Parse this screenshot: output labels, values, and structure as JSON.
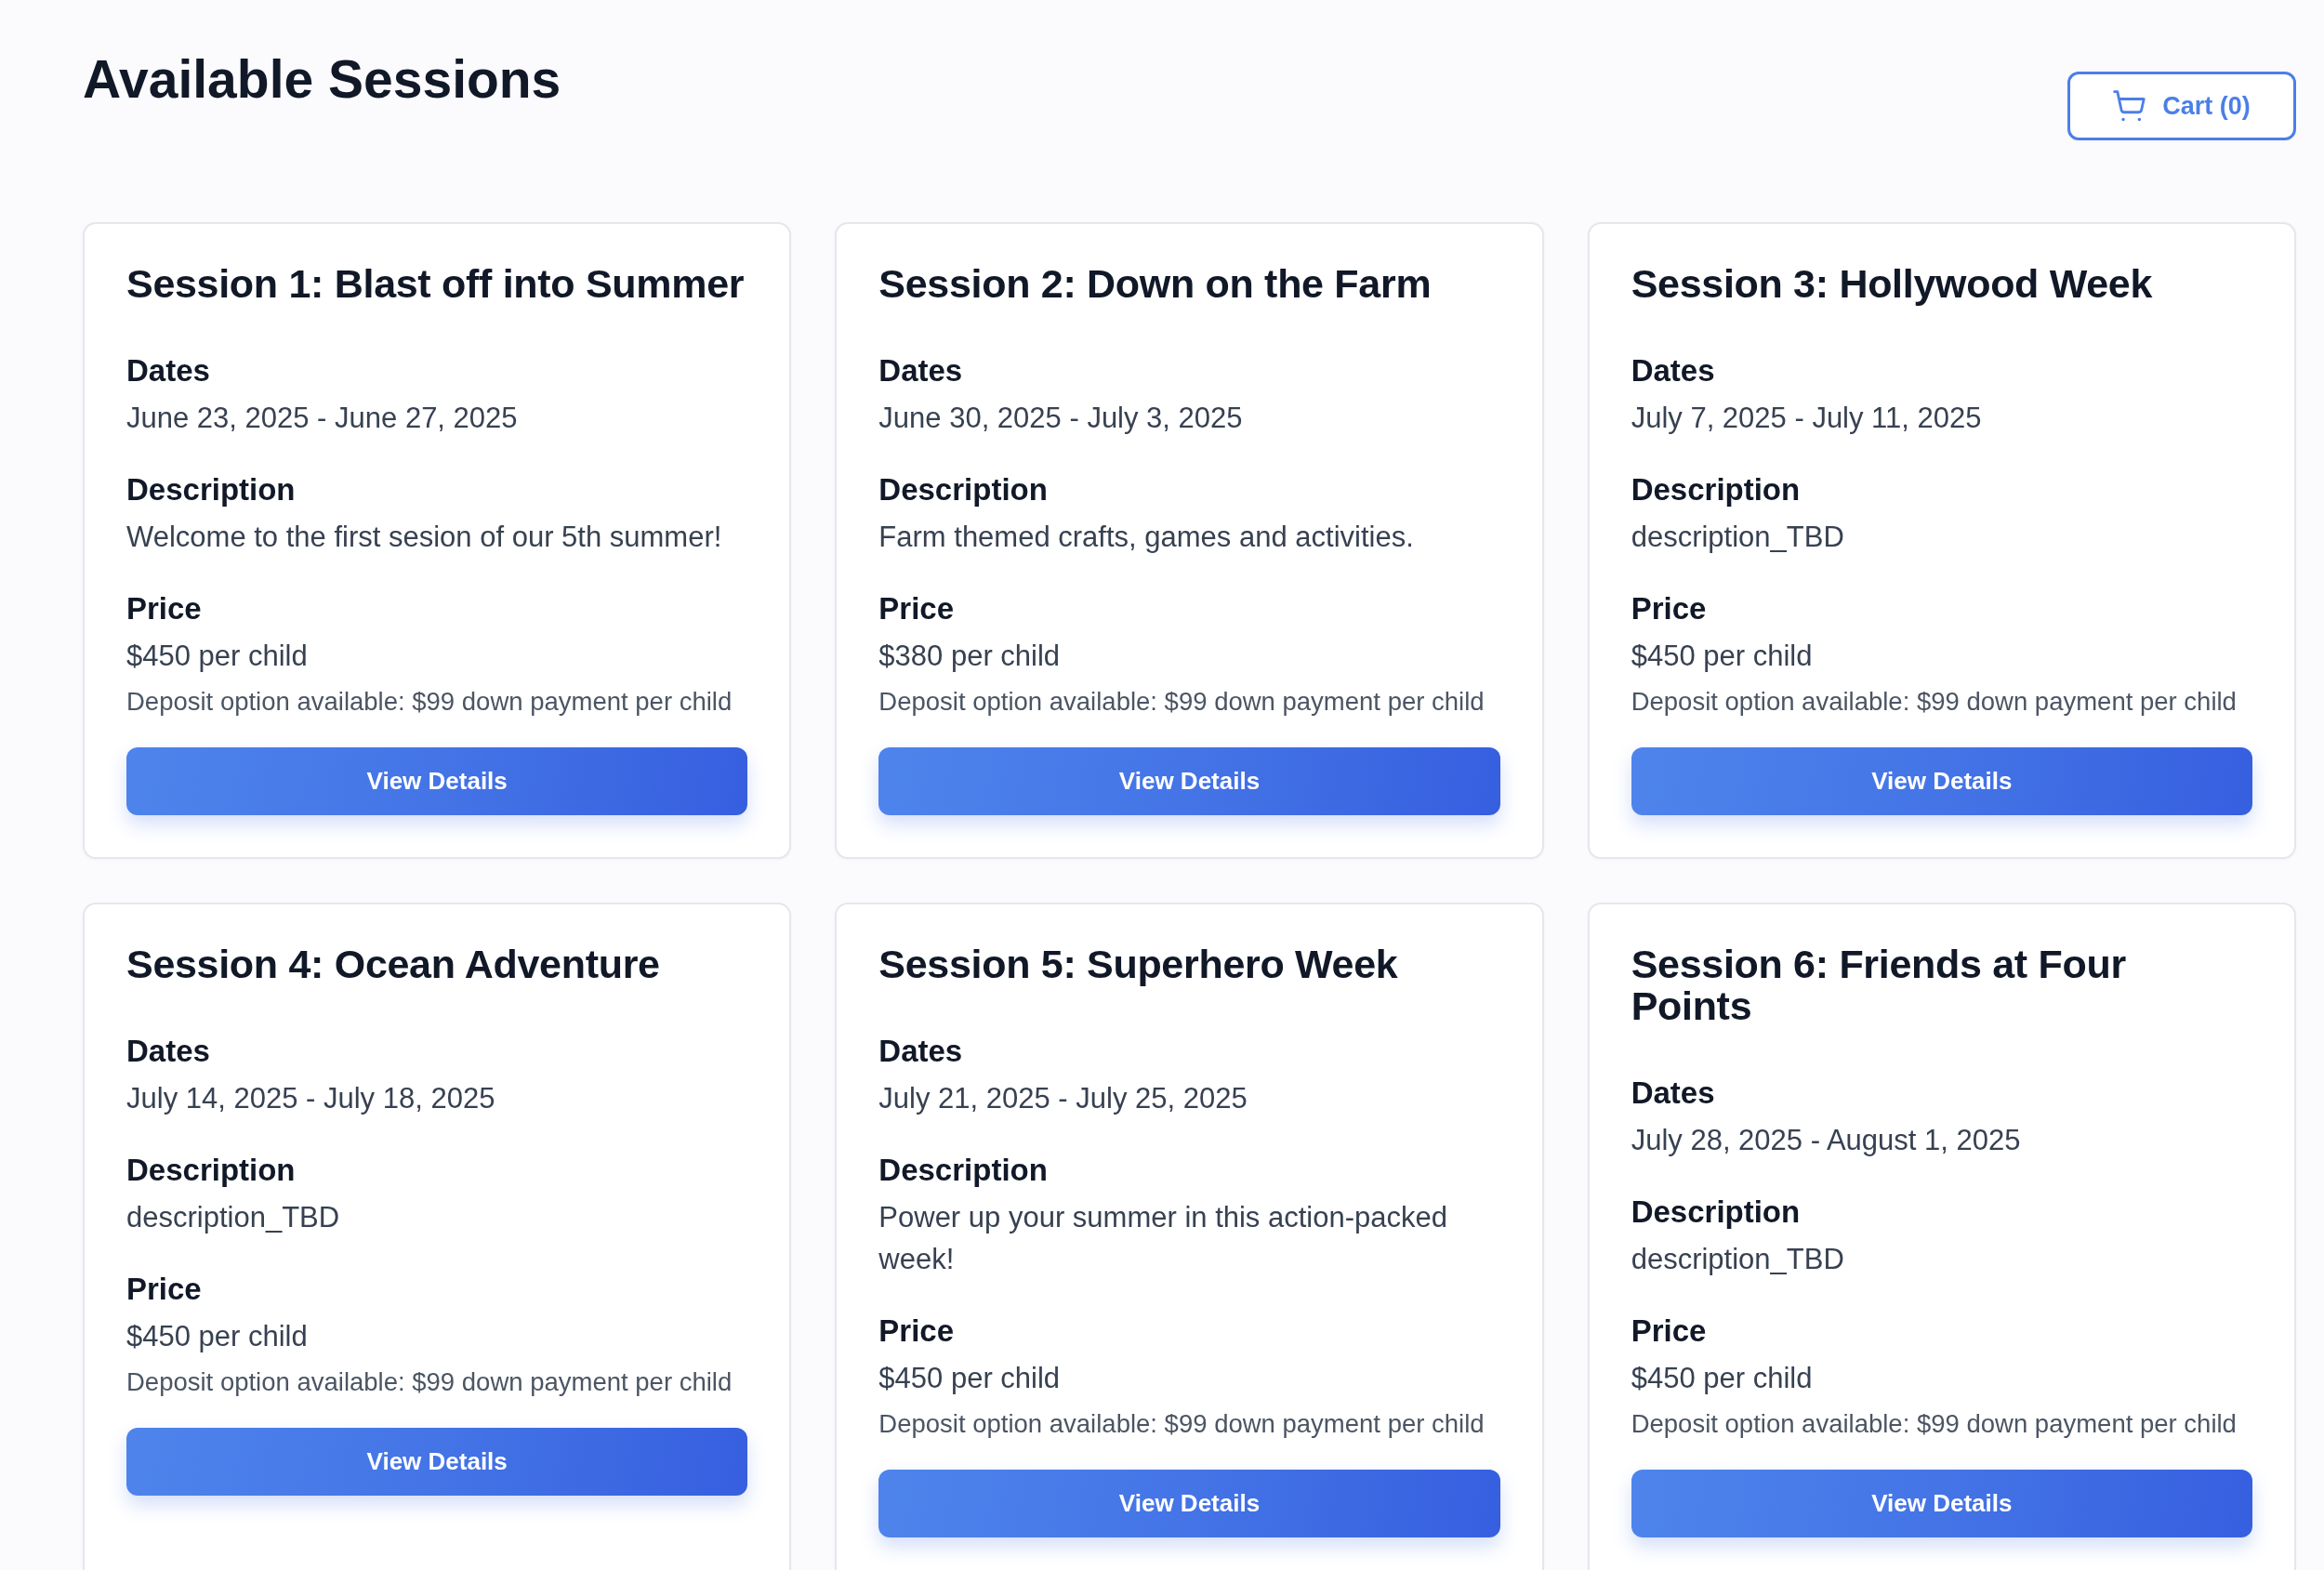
{
  "page": {
    "title": "Available Sessions"
  },
  "cart_button": {
    "label": "Cart (0)"
  },
  "sessions": [
    {
      "title": "Session 1: Blast off into Summer",
      "dates_label": "Dates",
      "dates": "June 23, 2025 - June 27, 2025",
      "description_label": "Description",
      "description": "Welcome to the first sesion of our 5th summer!",
      "price_label": "Price",
      "price": "$450 per child",
      "deposit_note": "Deposit option available: $99 down payment per child",
      "button": "View Details"
    },
    {
      "title": "Session 2: Down on the Farm",
      "dates_label": "Dates",
      "dates": "June 30, 2025 - July 3, 2025",
      "description_label": "Description",
      "description": "Farm themed crafts, games and activities.",
      "price_label": "Price",
      "price": "$380 per child",
      "deposit_note": "Deposit option available: $99 down payment per child",
      "button": "View Details"
    },
    {
      "title": "Session 3: Hollywood Week",
      "dates_label": "Dates",
      "dates": "July 7, 2025 - July 11, 2025",
      "description_label": "Description",
      "description": "description_TBD",
      "price_label": "Price",
      "price": "$450 per child",
      "deposit_note": "Deposit option available: $99 down payment per child",
      "button": "View Details"
    },
    {
      "title": "Session 4: Ocean Adventure",
      "dates_label": "Dates",
      "dates": "July 14, 2025 - July 18, 2025",
      "description_label": "Description",
      "description": "description_TBD",
      "price_label": "Price",
      "price": "$450 per child",
      "deposit_note": "Deposit option available: $99 down payment per child",
      "button": "View Details"
    },
    {
      "title": "Session 5: Superhero Week",
      "dates_label": "Dates",
      "dates": "July 21, 2025 - July 25, 2025",
      "description_label": "Description",
      "description": "Power up your summer in this action-packed week!",
      "price_label": "Price",
      "price": "$450 per child",
      "deposit_note": "Deposit option available: $99 down payment per child",
      "button": "View Details"
    },
    {
      "title": "Session 6: Friends at Four Points",
      "dates_label": "Dates",
      "dates": "July 28, 2025 - August 1, 2025",
      "description_label": "Description",
      "description": "description_TBD",
      "price_label": "Price",
      "price": "$450 per child",
      "deposit_note": "Deposit option available: $99 down payment per child",
      "button": "View Details"
    }
  ]
}
